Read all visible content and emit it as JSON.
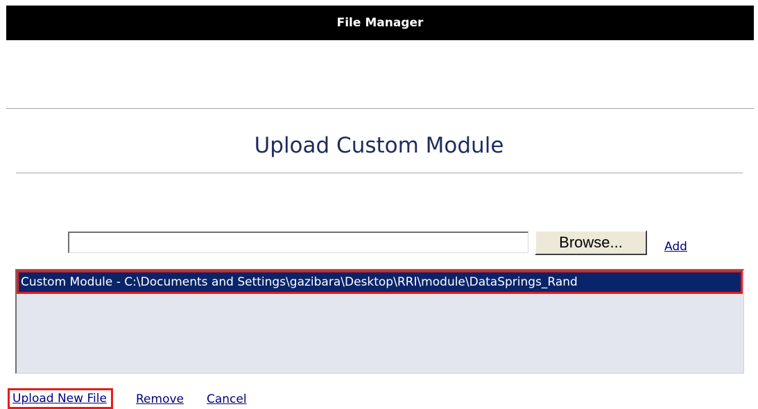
{
  "header": {
    "title": "File Manager"
  },
  "page": {
    "heading": "Upload Custom Module"
  },
  "upload_form": {
    "file_input_value": "",
    "browse_label": "Browse...",
    "add_label": "Add"
  },
  "file_list": {
    "items": [
      {
        "text": "Custom Module - C:\\Documents and Settings\\gazibara\\Desktop\\RRI\\module\\DataSprings_Rand",
        "selected": true
      }
    ]
  },
  "actions": {
    "upload_new_file_label": "Upload New File",
    "remove_label": "Remove",
    "cancel_label": "Cancel"
  },
  "colors": {
    "header_bg": "#000000",
    "heading_text": "#1f2b5c",
    "selection_bg": "#0a246a",
    "highlight_border": "#e81b1b",
    "link": "#000080",
    "listbox_bg": "#e3e6ee"
  }
}
